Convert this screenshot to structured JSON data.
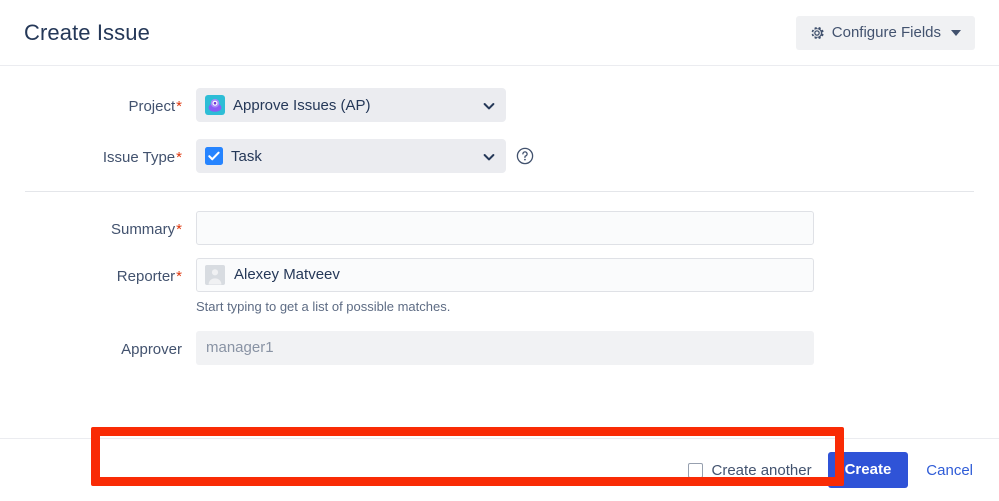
{
  "header": {
    "title": "Create Issue",
    "configure_fields_label": "Configure Fields",
    "gear_icon": "gear-icon",
    "caret_icon": "chevron-down-icon"
  },
  "form": {
    "project": {
      "label": "Project",
      "required": true,
      "value": "Approve Issues (AP)",
      "icon": "project-avatar-icon",
      "icon_colors": {
        "background": "#2dbdd6",
        "shape": "#8b5cf6"
      }
    },
    "issue_type": {
      "label": "Issue Type",
      "required": true,
      "value": "Task",
      "icon": "task-check-icon",
      "icon_color": "#2684ff",
      "help_icon": "help-circle-icon"
    },
    "summary": {
      "label": "Summary",
      "required": true,
      "value": "",
      "placeholder": ""
    },
    "reporter": {
      "label": "Reporter",
      "required": true,
      "value": "Alexey Matveev",
      "avatar_icon": "user-avatar-icon",
      "helper_text": "Start typing to get a list of possible matches."
    },
    "approver": {
      "label": "Approver",
      "required": false,
      "value": "",
      "placeholder": "manager1",
      "readonly": true,
      "highlighted": true,
      "highlight_color": "#f92b05"
    }
  },
  "footer": {
    "create_another_label": "Create another",
    "create_another_checked": false,
    "create_label": "Create",
    "cancel_label": "Cancel",
    "primary_color": "#2f53d7",
    "link_color": "#2f5cd7"
  }
}
